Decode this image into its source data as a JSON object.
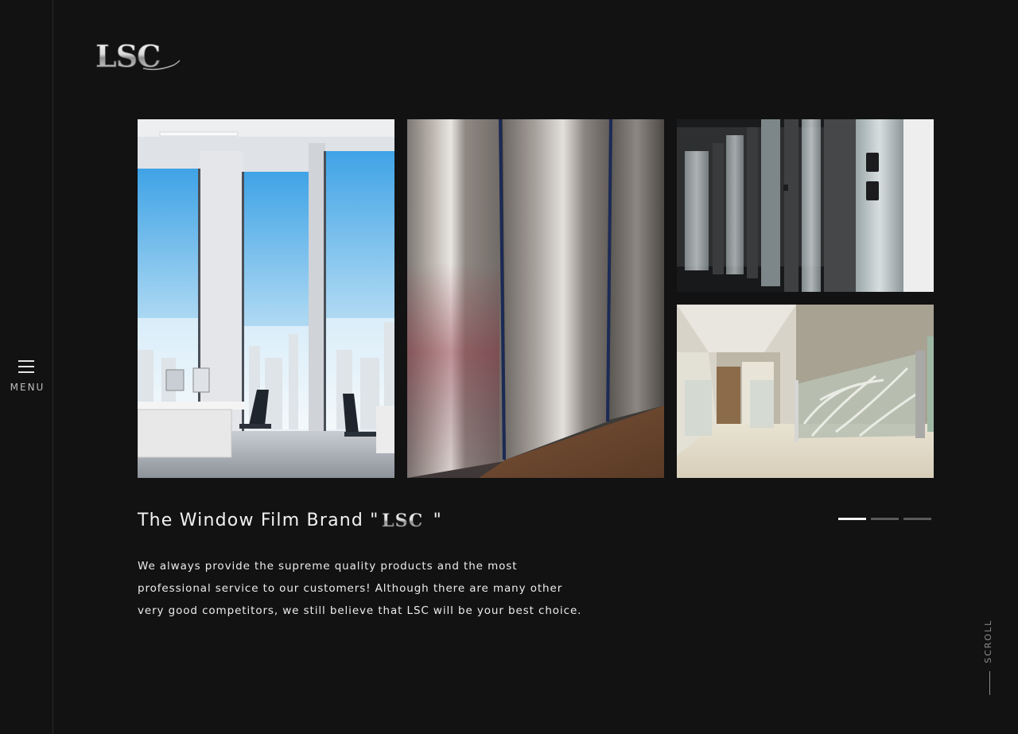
{
  "brand": {
    "logo_text": "LSC"
  },
  "nav": {
    "menu_label": "MENU"
  },
  "gallery": {
    "images": [
      {
        "icon": "office-window-image"
      },
      {
        "icon": "brushed-steel-partition-image"
      },
      {
        "icon": "restroom-partitions-image"
      },
      {
        "icon": "corridor-glass-railing-image"
      }
    ]
  },
  "hero": {
    "title_prefix": "The Window Film Brand \"",
    "title_logo": "LSC",
    "title_suffix": "\"",
    "description": "We always provide the supreme quality products and the most professional service to our customers! Although there are many other very good competitors, we still believe that LSC will be your best choice."
  },
  "carousel": {
    "slide_count": 3,
    "active_index": 0
  },
  "scroll": {
    "label": "SCROLL"
  },
  "colors": {
    "background": "#121213",
    "text": "#f2f2f2",
    "muted": "#8d8d8f",
    "dot_inactive": "#5a5a5c"
  }
}
